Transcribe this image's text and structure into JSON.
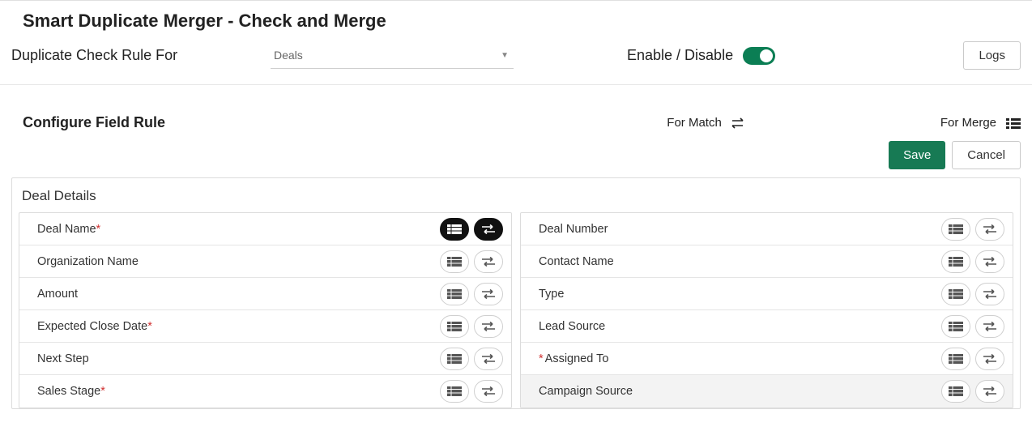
{
  "title": "Smart Duplicate Merger - Check and Merge",
  "header": {
    "label": "Duplicate Check Rule For",
    "selected": "Deals",
    "enable_label": "Enable / Disable",
    "logs": "Logs"
  },
  "config": {
    "title": "Configure Field Rule",
    "for_match": "For Match",
    "for_merge": "For Merge",
    "save": "Save",
    "cancel": "Cancel"
  },
  "panel_title": "Deal Details",
  "left_fields": [
    {
      "label": "Deal Name",
      "required_after": true,
      "active": true
    },
    {
      "label": "Organization Name",
      "required_after": false,
      "active": false
    },
    {
      "label": "Amount",
      "required_after": false,
      "active": false
    },
    {
      "label": "Expected Close Date",
      "required_after": true,
      "active": false
    },
    {
      "label": "Next Step",
      "required_after": false,
      "active": false
    },
    {
      "label": "Sales Stage",
      "required_after": true,
      "active": false
    }
  ],
  "right_fields": [
    {
      "label": "Deal Number",
      "required_before": false,
      "highlight": false
    },
    {
      "label": "Contact Name",
      "required_before": false,
      "highlight": false
    },
    {
      "label": "Type",
      "required_before": false,
      "highlight": false
    },
    {
      "label": "Lead Source",
      "required_before": false,
      "highlight": false
    },
    {
      "label": "Assigned To",
      "required_before": true,
      "highlight": false
    },
    {
      "label": "Campaign Source",
      "required_before": false,
      "highlight": true
    }
  ]
}
